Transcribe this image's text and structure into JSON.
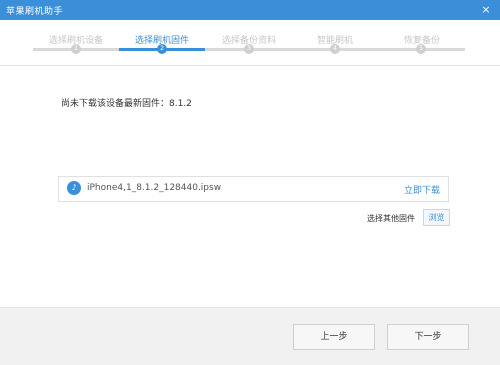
{
  "app": {
    "title": "苹果刷机助手",
    "close_glyph": "×"
  },
  "steps": [
    {
      "label": "选择刷机设备",
      "number": "1",
      "active": false
    },
    {
      "label": "选择刷机固件",
      "number": "2",
      "active": true
    },
    {
      "label": "选择备份资料",
      "number": "3",
      "active": false
    },
    {
      "label": "智能刷机",
      "number": "4",
      "active": false
    },
    {
      "label": "恢复备份",
      "number": "5",
      "active": false
    }
  ],
  "main": {
    "latest_text": "尚未下载该设备最新固件：8.1.2",
    "firmware": {
      "filename": "iPhone4,1_8.1.2_128440.ipsw",
      "download_label": "立即下载",
      "icon": "itunes-icon"
    },
    "choose_other_label": "选择其他固件",
    "browse_label": "浏览"
  },
  "footer": {
    "prev_label": "上一步",
    "next_label": "下一步"
  },
  "colors": {
    "accent": "#3b8fd9",
    "inactive": "#cfcfcf"
  }
}
